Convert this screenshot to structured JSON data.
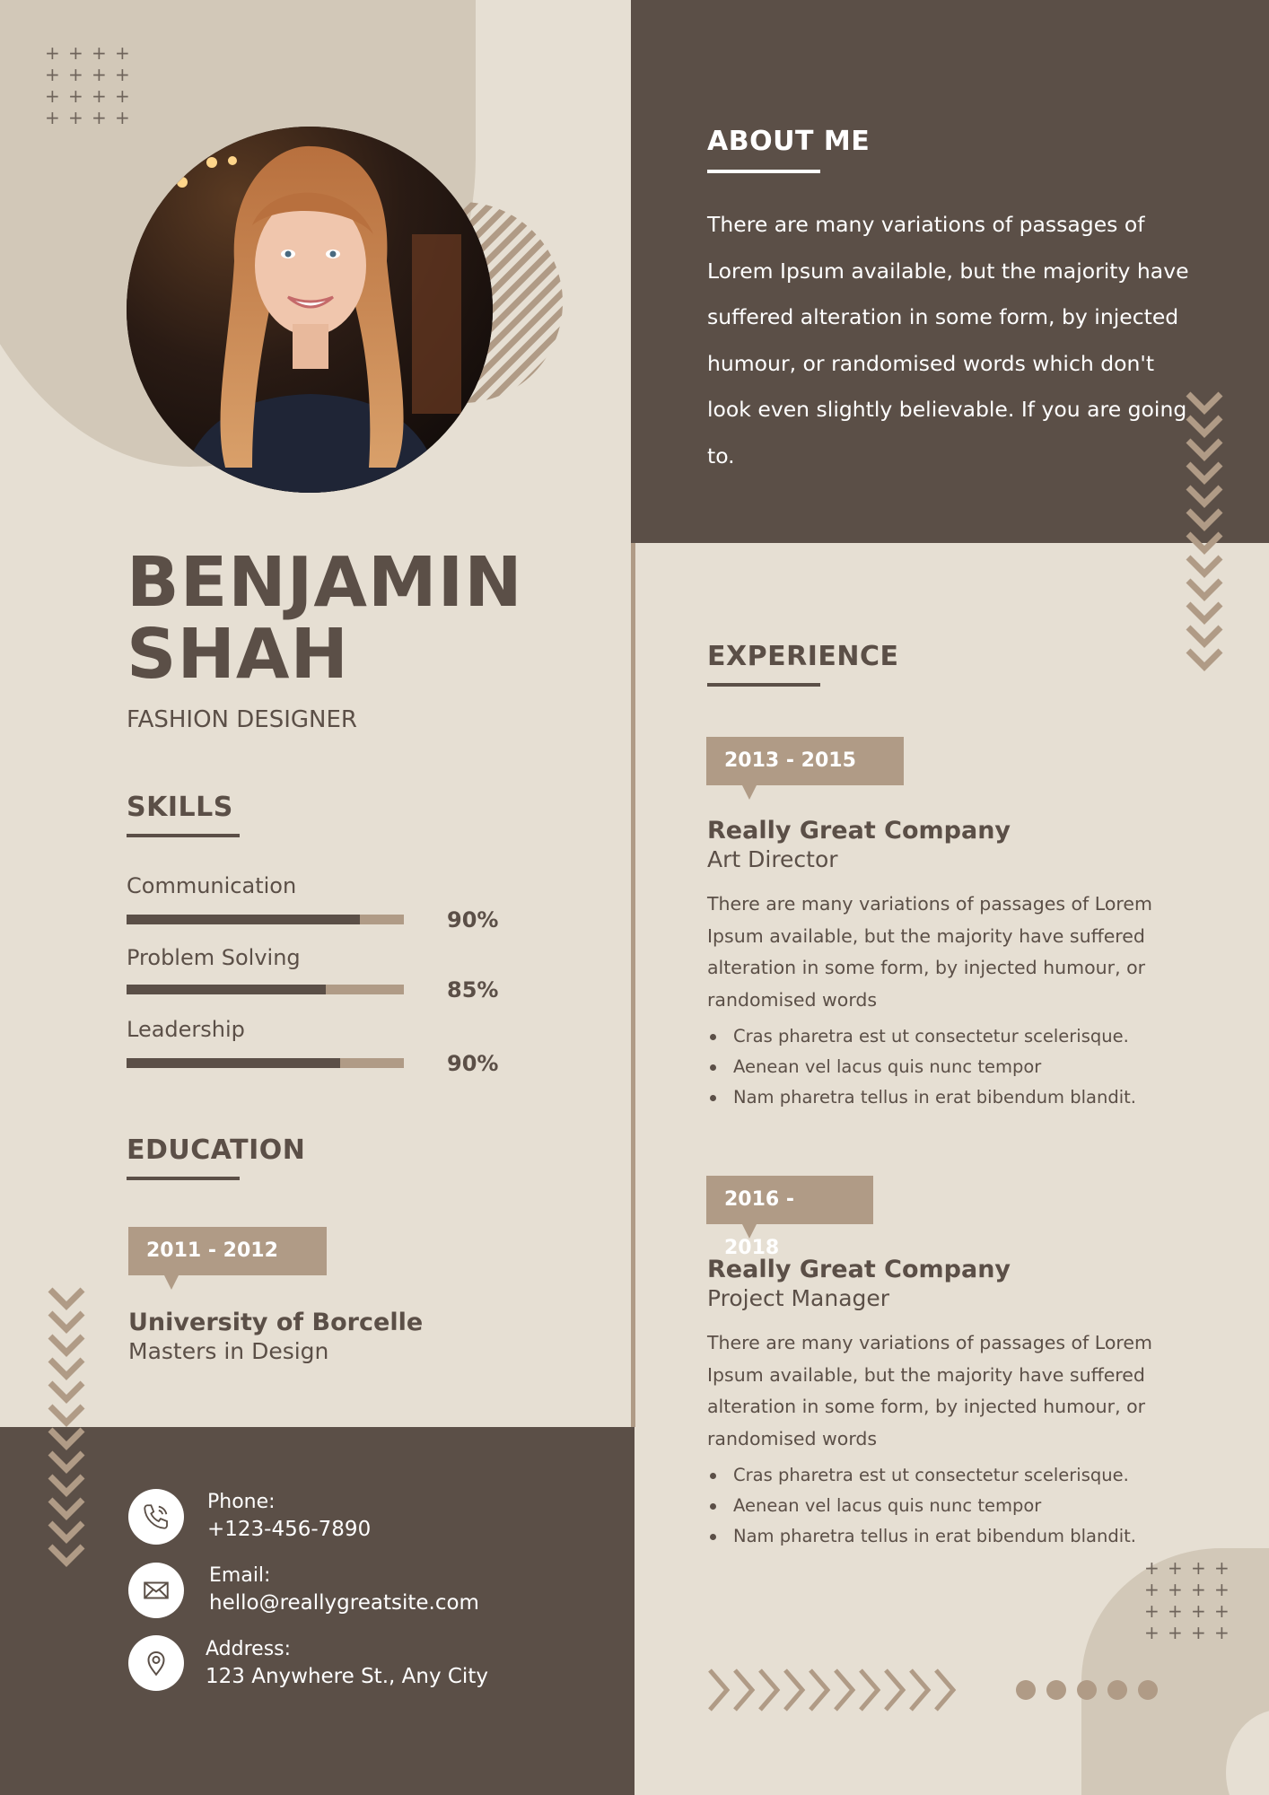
{
  "profile": {
    "first_name": "BENJAMIN",
    "last_name": "SHAH",
    "title": "FASHION DESIGNER"
  },
  "about": {
    "heading": "ABOUT ME",
    "text": "There are many variations of passages of Lorem Ipsum available, but the majority have suffered alteration in some form, by injected humour, or randomised words which don't look even slightly believable. If you are going to."
  },
  "skills": {
    "heading": "SKILLS",
    "items": [
      {
        "label": "Communication",
        "percent_text": "90%",
        "level": 0.84
      },
      {
        "label": "Problem Solving",
        "percent_text": "85%",
        "level": 0.72
      },
      {
        "label": "Leadership",
        "percent_text": "90%",
        "level": 0.77
      }
    ]
  },
  "education": {
    "heading": "EDUCATION",
    "items": [
      {
        "years": "2011 - 2012",
        "school": "University of Borcelle",
        "degree": "Masters in Design"
      }
    ]
  },
  "experience": {
    "heading": "EXPERIENCE",
    "items": [
      {
        "years": "2013 - 2015",
        "company": "Really Great Company",
        "role": "Art Director",
        "description": "There are many variations of passages of Lorem Ipsum available, but the majority have suffered alteration in some form, by injected humour, or randomised words",
        "bullets": [
          "Cras pharetra est ut consectetur scelerisque.",
          "Aenean vel lacus quis nunc tempor",
          "Nam pharetra tellus in erat bibendum blandit."
        ]
      },
      {
        "years": "2016 - 2018",
        "company": "Really Great Company",
        "role": "Project Manager",
        "description": "There are many variations of passages of Lorem Ipsum available, but the majority have suffered alteration in some form, by injected humour, or randomised words",
        "bullets": [
          "Cras pharetra est ut consectetur scelerisque.",
          "Aenean vel lacus quis nunc tempor",
          "Nam pharetra tellus in erat bibendum blandit."
        ]
      }
    ]
  },
  "contact": {
    "phone_label": "Phone:",
    "phone": "+123-456-7890",
    "email_label": "Email:",
    "email": "hello@reallygreatsite.com",
    "address_label": "Address:",
    "address": "123 Anywhere St., Any City",
    "icons": [
      "phone-icon",
      "mail-icon",
      "location-pin-icon"
    ]
  },
  "colors": {
    "dark": "#5b4f47",
    "accent": "#b09b86",
    "background": "#e6dfd3",
    "blob": "#d2c8b8"
  }
}
